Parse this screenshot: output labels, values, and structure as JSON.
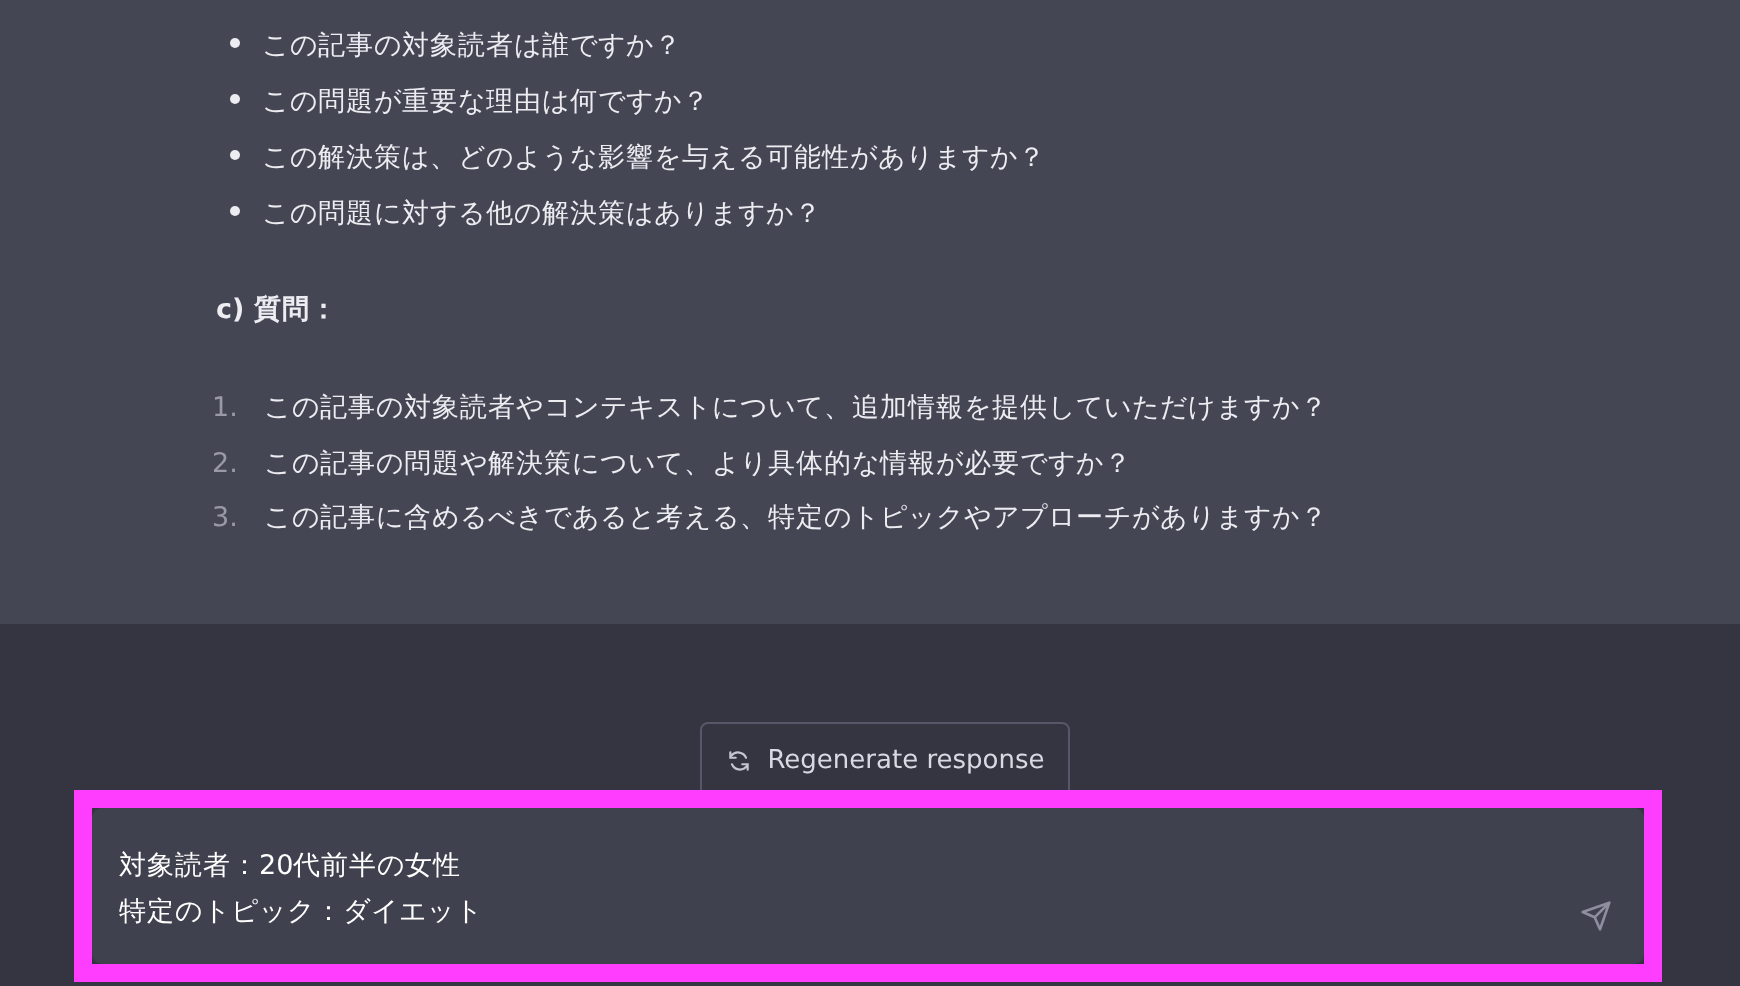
{
  "message": {
    "bullets": [
      "この記事の対象読者は誰ですか？",
      "この問題が重要な理由は何ですか？",
      "この解決策は、どのような影響を与える可能性がありますか？",
      "この問題に対する他の解決策はありますか？"
    ],
    "heading": "c) 質問：",
    "numbered": [
      {
        "number": "1.",
        "text": "この記事の対象読者やコンテキストについて、追加情報を提供していただけますか？"
      },
      {
        "number": "2.",
        "text": "この記事の問題や解決策について、より具体的な情報が必要ですか？"
      },
      {
        "number": "3.",
        "text": "この記事に含めるべきであると考える、特定のトピックやアプローチがありますか？"
      }
    ]
  },
  "regenerate_button": {
    "label": "Regenerate response"
  },
  "input": {
    "highlighted": true,
    "lines": [
      "対象読者：20代前半の女性",
      "特定のトピック：ダイエット"
    ]
  }
}
